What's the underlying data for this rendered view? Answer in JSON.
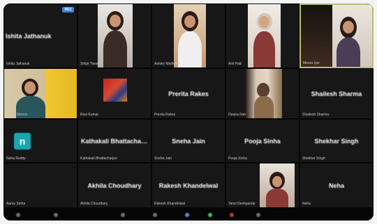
{
  "meeting": {
    "tiles": [
      {
        "id": "tile-1",
        "name": "Ishita Jathanuk",
        "caption": "Ishita Jathanuk",
        "badge": "REC",
        "type": "name"
      },
      {
        "id": "tile-2",
        "name": "",
        "caption": "Shilpi Tiwari",
        "type": "video"
      },
      {
        "id": "tile-3",
        "name": "",
        "caption": "Ashley Mathews",
        "type": "video"
      },
      {
        "id": "tile-4",
        "name": "",
        "caption": "Anil Patil",
        "type": "video"
      },
      {
        "id": "tile-5",
        "name": "",
        "caption": "Meera Iyer",
        "type": "video"
      },
      {
        "id": "tile-6",
        "name": "",
        "caption": "Kavita Menon",
        "type": "video"
      },
      {
        "id": "tile-7",
        "name": "",
        "caption": "Ravi Kumar",
        "type": "video"
      },
      {
        "id": "tile-8",
        "name": "Prerita Rakes",
        "caption": "Prerita Rakes",
        "type": "name"
      },
      {
        "id": "tile-9",
        "name": "",
        "caption": "Deepa Nair",
        "type": "video"
      },
      {
        "id": "tile-10",
        "name": "Shailesh Sharma",
        "caption": "Shailesh Sharma",
        "type": "name"
      },
      {
        "id": "tile-11",
        "name": "",
        "caption": "Neha Reddy",
        "type": "avatar",
        "initial": "n"
      },
      {
        "id": "tile-12",
        "name": "Kathakali Bhattacharjee",
        "caption": "Kathakali Bhattacharjee",
        "type": "name"
      },
      {
        "id": "tile-13",
        "name": "Sneha Jain",
        "caption": "Sneha Jain",
        "type": "name"
      },
      {
        "id": "tile-14",
        "name": "Pooja Sinha",
        "caption": "Pooja Sinha",
        "type": "name"
      },
      {
        "id": "tile-15",
        "name": "Shekhar Singh",
        "caption": "Shekhar Singh",
        "type": "name"
      },
      {
        "id": "tile-16",
        "name": "",
        "caption": "Aarav Sinha",
        "type": "blank"
      },
      {
        "id": "tile-17",
        "name": "Akhila Choudhary",
        "caption": "Akhila Choudhary",
        "type": "name"
      },
      {
        "id": "tile-18",
        "name": "Rakesh Khandelwal",
        "caption": "Rakesh Khandelwal",
        "type": "name"
      },
      {
        "id": "tile-19",
        "name": "",
        "caption": "Tanvi Deshpande",
        "type": "video"
      },
      {
        "id": "tile-20",
        "name": "Neha",
        "caption": "Neha",
        "type": "name"
      }
    ],
    "toolbar": {
      "items": [
        "mute-icon",
        "video-icon",
        "participants-icon",
        "chat-icon",
        "share-icon",
        "record-icon",
        "reactions-icon",
        "more-icon"
      ]
    }
  }
}
